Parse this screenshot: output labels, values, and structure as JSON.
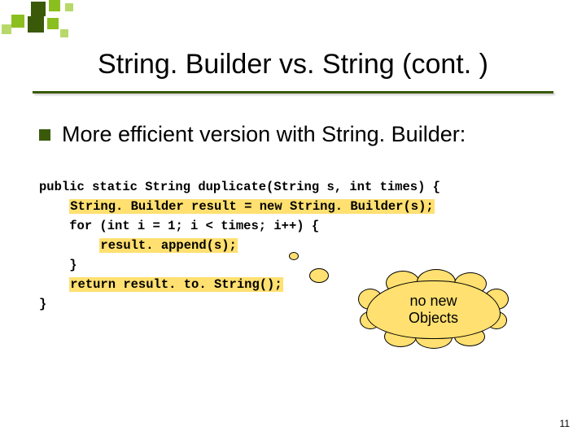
{
  "title": "String. Builder vs. String (cont. )",
  "bullet": "More efficient version with String. Builder:",
  "code": {
    "l1": "public static String duplicate(String s, int times) {",
    "l2": "String. Builder result = new String. Builder(s);",
    "l3a": "for (int i = 1; i < times; i++) {",
    "l4": "result. append(s);",
    "l5": "}",
    "l6": "return result. to. String();",
    "l7": "}"
  },
  "callout": "no new\nObjects",
  "page_number": "11"
}
